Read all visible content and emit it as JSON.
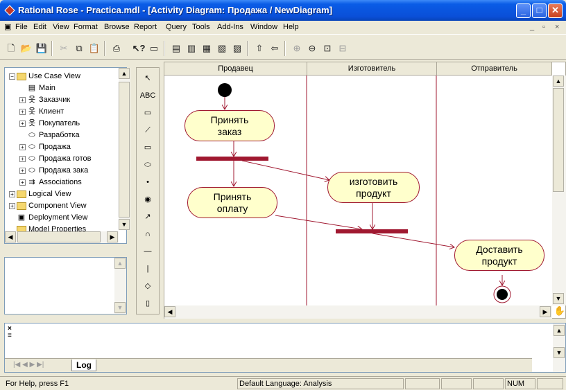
{
  "window": {
    "title": "Rational Rose - Practica.mdl - [Activity Diagram: Продажа / NewDiagram]"
  },
  "menu": [
    "File",
    "Edit",
    "View",
    "Format",
    "Browse",
    "Report",
    "Query",
    "Tools",
    "Add-Ins",
    "Window",
    "Help"
  ],
  "tree": {
    "items": [
      {
        "label": "Use Case View",
        "icon": "folder-icon",
        "expander": "−"
      },
      {
        "label": "Main",
        "icon": "class-diagram-icon",
        "expander": ""
      },
      {
        "label": "Заказчик",
        "icon": "actor-icon",
        "expander": "+"
      },
      {
        "label": "Клиент",
        "icon": "actor-icon",
        "expander": "+"
      },
      {
        "label": "Покупатель",
        "icon": "actor-icon",
        "expander": "+"
      },
      {
        "label": "Разработка",
        "icon": "use-case-icon",
        "expander": ""
      },
      {
        "label": "Продажа",
        "icon": "use-case-icon",
        "expander": "+"
      },
      {
        "label": "Продажа готов",
        "icon": "use-case-icon",
        "expander": "+"
      },
      {
        "label": "Продажа зака",
        "icon": "use-case-icon",
        "expander": "+"
      },
      {
        "label": "Associations",
        "icon": "associations-icon",
        "expander": "+"
      },
      {
        "label": "Logical View",
        "icon": "folder-icon",
        "expander": "+"
      },
      {
        "label": "Component View",
        "icon": "folder-icon",
        "expander": "+"
      },
      {
        "label": "Deployment View",
        "icon": "deployment-icon",
        "expander": ""
      },
      {
        "label": "Model Properties",
        "icon": "folder-icon",
        "expander": ""
      }
    ]
  },
  "palette": [
    "↖",
    "ABC",
    "▭",
    "⟋",
    "▭",
    "⬭",
    "•",
    "◉",
    "↗",
    "∩",
    "—",
    "|",
    "◇",
    "▯"
  ],
  "swimlanes": [
    "Продавец",
    "Изготовитель",
    "Отправитель"
  ],
  "states": [
    {
      "id": "accept-order",
      "text": "Принять\nзаказ"
    },
    {
      "id": "accept-payment",
      "text": "Принять\nоплату"
    },
    {
      "id": "make-product",
      "text": "изготовить\nпродукт"
    },
    {
      "id": "deliver-product",
      "text": "Доставить\nпродукт"
    }
  ],
  "log": {
    "tab": "Log"
  },
  "status": {
    "help": "For Help, press F1",
    "language": "Default Language: Analysis",
    "num": "NUM"
  }
}
